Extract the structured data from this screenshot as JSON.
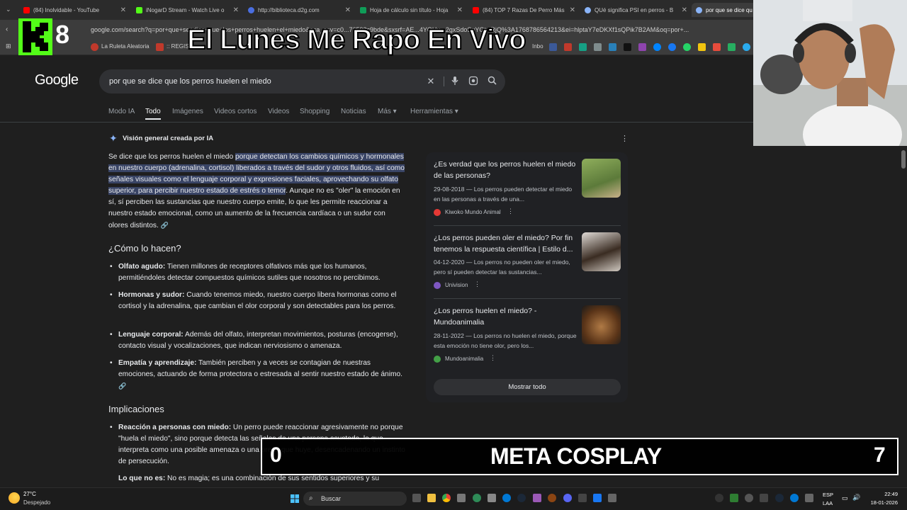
{
  "tabs": [
    {
      "label": "(84) Inolvidable - YouTube",
      "color": "#ff0000"
    },
    {
      "label": "iNogarD Stream - Watch Live o",
      "color": "#53fc18"
    },
    {
      "label": "http://biblioteca.d2g.com",
      "color": "#4a6ee0"
    },
    {
      "label": "Hoja de cálculo sin título - Hoja",
      "color": "#0f9d58"
    },
    {
      "label": "(84) TOP 7 Razas De Perro Más",
      "color": "#ff0000"
    },
    {
      "label": "QUé significa PSI en perros - B",
      "color": "#8ab4f8"
    },
    {
      "label": "por que se dice qu",
      "color": "#8ab4f8"
    }
  ],
  "url": "google.com/search?q=por+que+se+dice+que+los+perros+huelen+el+miedo&sca_esv=c0...76592c9bde&sxsrf=AE...4YQHu...2gxSdoSqYGtwRjQ%3A1768786564213&ei=hlptaY7eDKXf1sQPik7B2AM&oq=por+...",
  "bookmarks": [
    "La Ruleta Aleatoria",
    ":: REGIST",
    "Inbo"
  ],
  "overlay": {
    "channel_number": "8",
    "stream_title": "El Lunes Me Rapo En Vivo"
  },
  "google": {
    "logo": "Google",
    "query": "por que se dice que los perros huelen el miedo",
    "nav_tabs": [
      "Modo IA",
      "Todo",
      "Imágenes",
      "Videos cortos",
      "Videos",
      "Shopping",
      "Noticias",
      "Más ▾",
      "Herramientas ▾"
    ],
    "ai_overview_title": "Visión general creada por IA",
    "intro_plain": "Se dice que los perros huelen el miedo ",
    "intro_highlight": "porque detectan los cambios químicos y hormonales en nuestro cuerpo (adrenalina, cortisol) liberados a través del sudor y otros fluidos, así como señales visuales como el lenguaje corporal y expresiones faciales, aprovechando su olfato superior, para percibir nuestro estado de estrés o temor",
    "intro_rest": ". Aunque no es \"oler\" la emoción en sí, sí perciben las sustancias que nuestro cuerpo emite, lo que les permite reaccionar a nuestro estado emocional, como un aumento de la frecuencia cardíaca o un sudor con olores distintos.",
    "section1": "¿Cómo lo hacen?",
    "bullets1": [
      {
        "b": "Olfato agudo:",
        "t": " Tienen millones de receptores olfativos más que los humanos, permitiéndoles detectar compuestos químicos sutiles que nosotros no percibimos."
      },
      {
        "b": "Hormonas y sudor:",
        "t": " Cuando tenemos miedo, nuestro cuerpo libera hormonas como el cortisol y la adrenalina, que cambian el olor corporal y son detectables para los perros."
      },
      {
        "b": "Lenguaje corporal:",
        "t": " Además del olfato, interpretan movimientos, posturas (encogerse), contacto visual y vocalizaciones, que indican nerviosismo o amenaza."
      },
      {
        "b": "Empatía y aprendizaje:",
        "t": " También perciben y a veces se contagian de nuestras emociones, actuando de forma protectora o estresada al sentir nuestro estado de ánimo."
      }
    ],
    "section2": "Implicaciones",
    "bullets2": [
      {
        "b": "Reacción a personas con miedo:",
        "t": " Un perro puede reaccionar agresivamente no porque \"huela el miedo\", sino porque detecta las señales de una persona asustada, lo que interpreta como una posible amenaza o una presa que huye, desencadenando un instinto de persecución."
      },
      {
        "b": "Lo que no es:",
        "t": " No es magia; es una combinación de sus sentidos superiores y su"
      }
    ],
    "cards": [
      {
        "title": "¿Es verdad que los perros huelen el miedo de las personas?",
        "snippet": "29-08-2018 — Los perros pueden detectar el miedo en las personas a través de una...",
        "source": "Kiwoko Mundo Animal",
        "src_color": "#e53935",
        "img_color": "#6f8a4a"
      },
      {
        "title": "¿Los perros pueden oler el miedo? Por fin tenemos la respuesta científica | Estilo d...",
        "snippet": "04-12-2020 — Los perros no pueden oler el miedo, pero sí pueden detectar las sustancias...",
        "source": "Univision",
        "src_color": "#7e57c2",
        "img_color": "#c9c2bb"
      },
      {
        "title": "¿Los perros huelen el miedo? - Mundoanimalia",
        "snippet": "28-11-2022 — Los perros no huelen el miedo, porque esta emoción no tiene olor, pero los...",
        "source": "Mundoanimalia",
        "src_color": "#43a047",
        "img_color": "#7a4a26"
      }
    ],
    "show_all": "Mostrar todo"
  },
  "scoreboard": {
    "left": "0",
    "title": "META COSPLAY",
    "right": "7"
  },
  "taskbar": {
    "temp": "27°C",
    "weather": "Despejado",
    "search": "Buscar",
    "lang1": "ESP",
    "lang2": "LAA",
    "time": "22:49",
    "date": "18-01-2026"
  }
}
